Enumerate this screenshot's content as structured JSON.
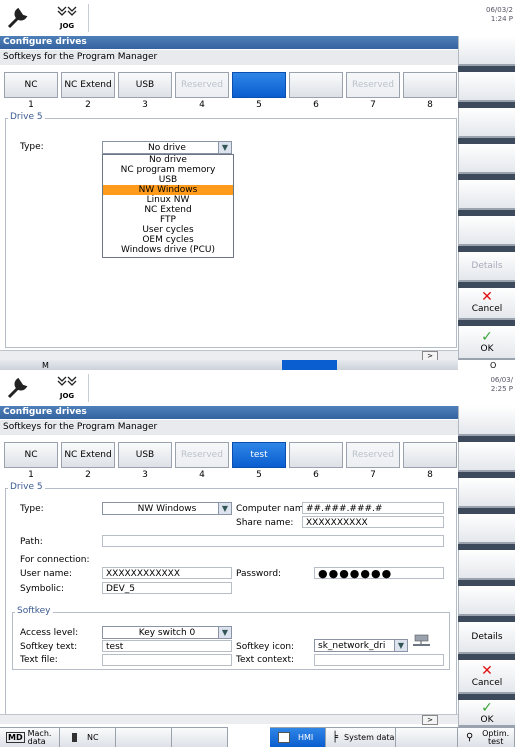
{
  "top": {
    "date": "06/03/2",
    "time": "1:24 P",
    "title": "Configure drives",
    "subtitle": "Softkeys for the Program Manager",
    "softkeys": [
      {
        "label": "NC",
        "state": "normal"
      },
      {
        "label": "NC Extend",
        "state": "normal"
      },
      {
        "label": "USB",
        "state": "normal"
      },
      {
        "label": "Reserved",
        "state": "disabled"
      },
      {
        "label": "",
        "state": "selected"
      },
      {
        "label": "",
        "state": "normal"
      },
      {
        "label": "Reserved",
        "state": "disabled"
      },
      {
        "label": "",
        "state": "normal"
      }
    ],
    "numbers": [
      "1",
      "2",
      "3",
      "4",
      "5",
      "6",
      "7",
      "8"
    ],
    "group_label": "Drive 5",
    "type_label": "Type:",
    "type_value": "No drive",
    "options": [
      "No drive",
      "NC program memory",
      "USB",
      "NW Windows",
      "Linux NW",
      "NC Extend",
      "FTP",
      "User cycles",
      "OEM cycles",
      "Windows drive (PCU)"
    ],
    "highlighted": 3,
    "right": {
      "details": "Details",
      "cancel": "Cancel",
      "ok": "OK"
    },
    "bottom_partial": [
      "M",
      "O",
      "O"
    ]
  },
  "bottom": {
    "date": "06/03/",
    "time": "2:25 P",
    "title": "Configure drives",
    "subtitle": "Softkeys for the Program Manager",
    "softkeys": [
      {
        "label": "NC",
        "state": "normal"
      },
      {
        "label": "NC Extend",
        "state": "normal"
      },
      {
        "label": "USB",
        "state": "normal"
      },
      {
        "label": "Reserved",
        "state": "disabled"
      },
      {
        "label": "test",
        "state": "selected"
      },
      {
        "label": "",
        "state": "normal"
      },
      {
        "label": "Reserved",
        "state": "disabled"
      },
      {
        "label": "",
        "state": "normal"
      }
    ],
    "numbers": [
      "1",
      "2",
      "3",
      "4",
      "5",
      "6",
      "7",
      "8"
    ],
    "group_label": "Drive 5",
    "fields": {
      "type_label": "Type:",
      "type_value": "NW Windows",
      "computer_name_label": "Computer name:",
      "computer_name_value": "##.###.###.#",
      "share_name_label": "Share name:",
      "share_name_value": "XXXXXXXXXX",
      "path_label": "Path:",
      "path_value": "",
      "for_connection_label": "For connection:",
      "user_name_label": "User name:",
      "user_name_value": "XXXXXXXXXXXX",
      "password_label": "Password:",
      "password_value": "●●●●●●●",
      "symbolic_label": "Symbolic:",
      "symbolic_value": "DEV_5"
    },
    "softkey_group_label": "Softkey",
    "softkey_fields": {
      "access_level_label": "Access level:",
      "access_level_value": "Key switch 0",
      "softkey_text_label": "Softkey text:",
      "softkey_text_value": "test",
      "softkey_icon_label": "Softkey icon:",
      "softkey_icon_value": "sk_network_dri",
      "text_file_label": "Text file:",
      "text_file_value": "",
      "text_context_label": "Text context:",
      "text_context_value": ""
    },
    "right": {
      "details": "Details",
      "cancel": "Cancel",
      "ok": "OK"
    },
    "hbar": {
      "mach_data": "Mach. data",
      "nc": "NC",
      "hmi": "HMI",
      "system_data": "System data",
      "optim_test": "Optim. test"
    },
    "md_tag": "MD"
  },
  "jog_label": "JOG",
  "colors": {
    "accent_blue": "#0a5ed0",
    "title_blue": "#3b6aa8",
    "highlight_orange": "#ff9a1a",
    "cancel_red": "#e01010",
    "ok_green": "#3aa63a"
  }
}
